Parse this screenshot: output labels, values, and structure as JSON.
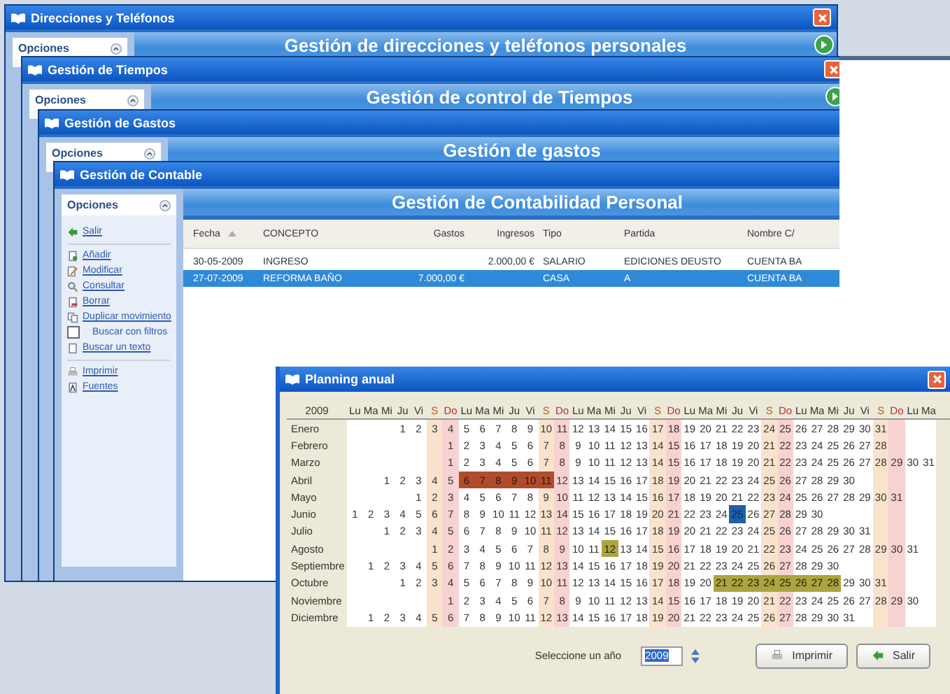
{
  "background_windows": [
    {
      "title": "Direcciones y Teléfonos",
      "heading": "Gestión de direcciones y teléfonos personales",
      "panel_title": "Opciones"
    },
    {
      "title": "Gestión de Tiempos",
      "heading": "Gestión de control de Tiempos",
      "panel_title": "Opciones"
    },
    {
      "title": "Gestión de Gastos",
      "heading": "Gestión de gastos",
      "panel_title": "Opciones"
    }
  ],
  "accounting_window": {
    "title": "Gestión de Contable",
    "heading": "Gestión de Contabilidad Personal",
    "panel_title": "Opciones",
    "sidebar_groups": [
      [
        {
          "label": "Salir",
          "kind": "link"
        }
      ],
      [
        {
          "label": "Añadir",
          "kind": "link"
        },
        {
          "label": "Modificar",
          "kind": "link"
        },
        {
          "label": "Consultar",
          "kind": "link"
        },
        {
          "label": "Borrar",
          "kind": "link"
        },
        {
          "label": "Duplicar movimiento",
          "kind": "link"
        },
        {
          "label": "Buscar con filtros",
          "kind": "checkbox",
          "checked": false
        },
        {
          "label": "Buscar un texto",
          "kind": "link"
        }
      ],
      [
        {
          "label": "Imprimir",
          "kind": "link"
        },
        {
          "label": "Fuentes",
          "kind": "link"
        }
      ]
    ],
    "table": {
      "columns": [
        "Fecha",
        "CONCEPTO",
        "Gastos",
        "Ingresos",
        "Tipo",
        "Partida",
        "Nombre C/"
      ],
      "rows": [
        {
          "cells": [
            "30-05-2009",
            "INGRESO",
            null,
            "2.000,00 €",
            "SALARIO",
            "EDICIONES DEUSTO",
            "CUENTA BA"
          ],
          "selected": false
        },
        {
          "cells": [
            "27-07-2009",
            "REFORMA BAÑO",
            "7.000,00 €",
            null,
            "CASA",
            "A",
            "CUENTA BA"
          ],
          "selected": true
        }
      ]
    }
  },
  "planning_window": {
    "title": "Planning anual",
    "year": "2009",
    "weekdays": [
      "Lu",
      "Ma",
      "Mi",
      "Ju",
      "Vi",
      "S",
      "Do",
      "Lu",
      "Ma",
      "Mi",
      "Ju",
      "Vi",
      "S",
      "Do",
      "Lu",
      "Ma",
      "Mi",
      "Ju",
      "Vi",
      "S",
      "Do",
      "Lu",
      "Ma",
      "Mi",
      "Ju",
      "Vi",
      "S",
      "Do",
      "Lu",
      "Ma",
      "Mi",
      "Ju",
      "Vi",
      "S",
      "Do",
      "Lu",
      "Ma"
    ],
    "months": [
      {
        "name": "Enero",
        "cells": [
          null,
          null,
          null,
          "1",
          "2",
          "3",
          "4",
          "5",
          "6",
          "7",
          "8",
          "9",
          "10",
          "11",
          "12",
          "13",
          "14",
          "15",
          "16",
          "17",
          "18",
          "19",
          "20",
          "21",
          "22",
          "23",
          "24",
          "25",
          "26",
          "27",
          "28",
          "29",
          "30",
          "31"
        ]
      },
      {
        "name": "Febrero",
        "cells": [
          null,
          null,
          null,
          null,
          null,
          null,
          "1",
          "2",
          "3",
          "4",
          "5",
          "6",
          "7",
          "8",
          "9",
          "10",
          "11",
          "12",
          "13",
          "14",
          "15",
          "16",
          "17",
          "18",
          "19",
          "20",
          "21",
          "22",
          "23",
          "24",
          "25",
          "26",
          "27",
          "28"
        ]
      },
      {
        "name": "Marzo",
        "cells": [
          null,
          null,
          null,
          null,
          null,
          null,
          "1",
          "2",
          "3",
          "4",
          "5",
          "6",
          "7",
          "8",
          "9",
          "10",
          "11",
          "12",
          "13",
          "14",
          "15",
          "16",
          "17",
          "18",
          "19",
          "20",
          "21",
          "22",
          "23",
          "24",
          "25",
          "26",
          "27",
          "28",
          "29",
          "30",
          "31"
        ]
      },
      {
        "name": "Abril",
        "cells": [
          null,
          null,
          "1",
          "2",
          "3",
          "4",
          "5",
          {
            "day": "6",
            "kind": "vacation"
          },
          {
            "day": "7",
            "kind": "vacation"
          },
          {
            "day": "8",
            "kind": "vacation"
          },
          {
            "day": "9",
            "kind": "vacation"
          },
          {
            "day": "10",
            "kind": "vacation"
          },
          {
            "day": "11",
            "kind": "vacation"
          },
          "12",
          "13",
          "14",
          "15",
          "16",
          "17",
          "18",
          "19",
          "20",
          "21",
          "22",
          "23",
          "24",
          "25",
          "26",
          "27",
          "28",
          "29",
          "30"
        ]
      },
      {
        "name": "Mayo",
        "cells": [
          null,
          null,
          null,
          null,
          "1",
          "2",
          "3",
          "4",
          "5",
          "6",
          "7",
          "8",
          "9",
          "10",
          "11",
          "12",
          "13",
          "14",
          "15",
          "16",
          "17",
          "18",
          "19",
          "20",
          "21",
          "22",
          "23",
          "24",
          "25",
          "26",
          "27",
          "28",
          "29",
          "30",
          "31"
        ]
      },
      {
        "name": "Junio",
        "cells": [
          "1",
          "2",
          "3",
          "4",
          "5",
          "6",
          "7",
          "8",
          "9",
          "10",
          "11",
          "12",
          "13",
          "14",
          "15",
          "16",
          "17",
          "18",
          "19",
          "20",
          "21",
          "22",
          "23",
          "24",
          {
            "day": "25",
            "kind": "current"
          },
          "26",
          "27",
          "28",
          "29",
          "30"
        ]
      },
      {
        "name": "Julio",
        "cells": [
          null,
          null,
          "1",
          "2",
          "3",
          "4",
          "5",
          "6",
          "7",
          "8",
          "9",
          "10",
          "11",
          "12",
          "13",
          "14",
          "15",
          "16",
          "17",
          "18",
          "19",
          "20",
          "21",
          "22",
          "23",
          "24",
          "25",
          "26",
          "27",
          "28",
          "29",
          "30",
          "31"
        ]
      },
      {
        "name": "Agosto",
        "cells": [
          null,
          null,
          null,
          null,
          null,
          "1",
          "2",
          "3",
          "4",
          "5",
          "6",
          "7",
          "8",
          "9",
          "10",
          "11",
          {
            "day": "12",
            "kind": "event"
          },
          "13",
          "14",
          "15",
          "16",
          "17",
          "18",
          "19",
          "20",
          "21",
          "22",
          "23",
          "24",
          "25",
          "26",
          "27",
          "28",
          "29",
          "30",
          "31"
        ]
      },
      {
        "name": "Septiembre",
        "cells": [
          null,
          "1",
          "2",
          "3",
          "4",
          "5",
          "6",
          "7",
          "8",
          "9",
          "10",
          "11",
          "12",
          "13",
          "14",
          "15",
          "16",
          "17",
          "18",
          "19",
          "20",
          "21",
          "22",
          "23",
          "24",
          "25",
          "26",
          "27",
          "28",
          "29",
          "30"
        ]
      },
      {
        "name": "Octubre",
        "cells": [
          null,
          null,
          null,
          "1",
          "2",
          "3",
          "4",
          "5",
          "6",
          "7",
          "8",
          "9",
          "10",
          "11",
          "12",
          "13",
          "14",
          "15",
          "16",
          "17",
          "18",
          "19",
          "20",
          {
            "day": "21",
            "kind": "event"
          },
          {
            "day": "22",
            "kind": "event"
          },
          {
            "day": "23",
            "kind": "event"
          },
          {
            "day": "24",
            "kind": "event"
          },
          {
            "day": "25",
            "kind": "event"
          },
          {
            "day": "26",
            "kind": "event"
          },
          {
            "day": "27",
            "kind": "event"
          },
          {
            "day": "28",
            "kind": "event"
          },
          "29",
          "30",
          "31"
        ]
      },
      {
        "name": "Noviembre",
        "cells": [
          null,
          null,
          null,
          null,
          null,
          null,
          "1",
          "2",
          "3",
          "4",
          "5",
          "6",
          "7",
          "8",
          "9",
          "10",
          "11",
          "12",
          "13",
          "14",
          "15",
          "16",
          "17",
          "18",
          "19",
          "20",
          "21",
          "22",
          "23",
          "24",
          "25",
          "26",
          "27",
          "28",
          "29",
          "30"
        ]
      },
      {
        "name": "Diciembre",
        "cells": [
          null,
          "1",
          "2",
          "3",
          "4",
          "5",
          "6",
          "7",
          "8",
          "9",
          "10",
          "11",
          "12",
          "13",
          "14",
          "15",
          "16",
          "17",
          "18",
          "19",
          "20",
          "21",
          "22",
          "23",
          "24",
          "25",
          "26",
          "27",
          "28",
          "29",
          "30",
          "31"
        ]
      }
    ],
    "year_label": "Seleccione un año",
    "year_value": "2009",
    "buttons": [
      "Imprimir",
      "Salir"
    ]
  }
}
